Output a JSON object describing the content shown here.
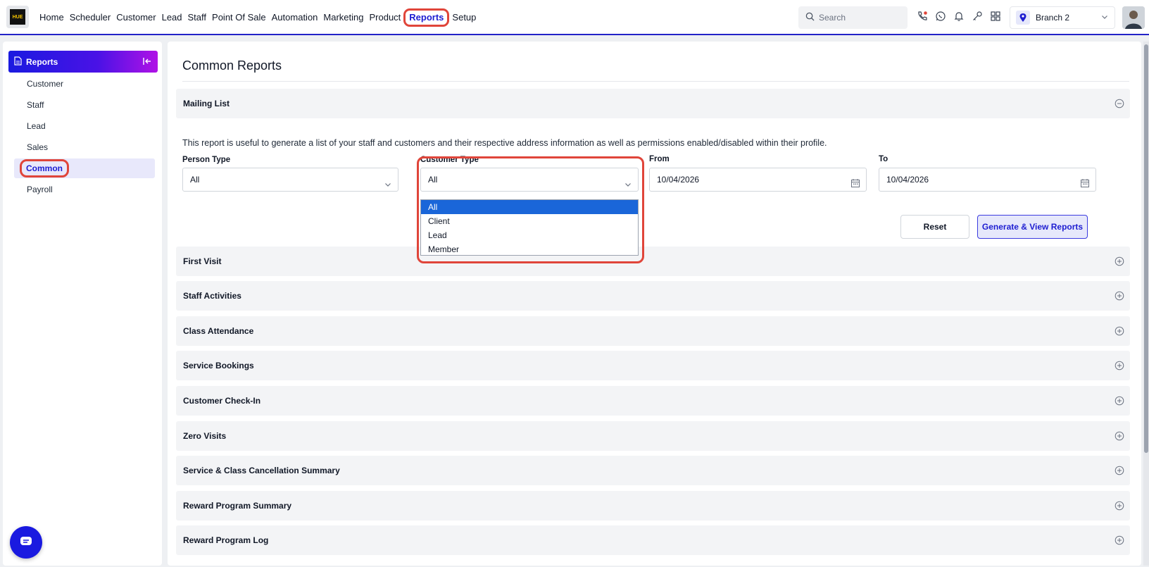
{
  "nav": {
    "logo_text": "HUE",
    "items": [
      {
        "label": "Home"
      },
      {
        "label": "Scheduler"
      },
      {
        "label": "Customer"
      },
      {
        "label": "Lead"
      },
      {
        "label": "Staff"
      },
      {
        "label": "Point Of Sale"
      },
      {
        "label": "Automation"
      },
      {
        "label": "Marketing"
      },
      {
        "label": "Product"
      },
      {
        "label": "Reports",
        "active": true
      },
      {
        "label": "Setup"
      }
    ],
    "search_placeholder": "Search",
    "branch": "Branch 2"
  },
  "sidebar": {
    "title": "Reports",
    "items": [
      {
        "label": "Customer"
      },
      {
        "label": "Staff"
      },
      {
        "label": "Lead"
      },
      {
        "label": "Sales"
      },
      {
        "label": "Common",
        "active": true
      },
      {
        "label": "Payroll"
      }
    ]
  },
  "main": {
    "title": "Common Reports",
    "mailing_list": {
      "title": "Mailing List",
      "description": "This report is useful to generate a list of your staff and customers and their respective address information as well as permissions enabled/disabled within their profile.",
      "person_type": {
        "label": "Person Type",
        "value": "All"
      },
      "customer_type": {
        "label": "Customer Type",
        "value": "All",
        "options": [
          "All",
          "Client",
          "Lead",
          "Member"
        ],
        "selected_index": 0
      },
      "from": {
        "label": "From",
        "value": "10/04/2026"
      },
      "to": {
        "label": "To",
        "value": "10/04/2026"
      },
      "reset_label": "Reset",
      "generate_label": "Generate & View Reports"
    },
    "sections": [
      {
        "title": "First Visit"
      },
      {
        "title": "Staff Activities"
      },
      {
        "title": "Class Attendance"
      },
      {
        "title": "Service Bookings"
      },
      {
        "title": "Customer Check-In"
      },
      {
        "title": "Zero Visits"
      },
      {
        "title": "Service & Class Cancellation Summary"
      },
      {
        "title": "Reward Program Summary"
      },
      {
        "title": "Reward Program Log"
      }
    ]
  },
  "colors": {
    "accent": "#1d1dd1",
    "highlight": "#e0453a",
    "selected_option": "#1a66d9"
  }
}
